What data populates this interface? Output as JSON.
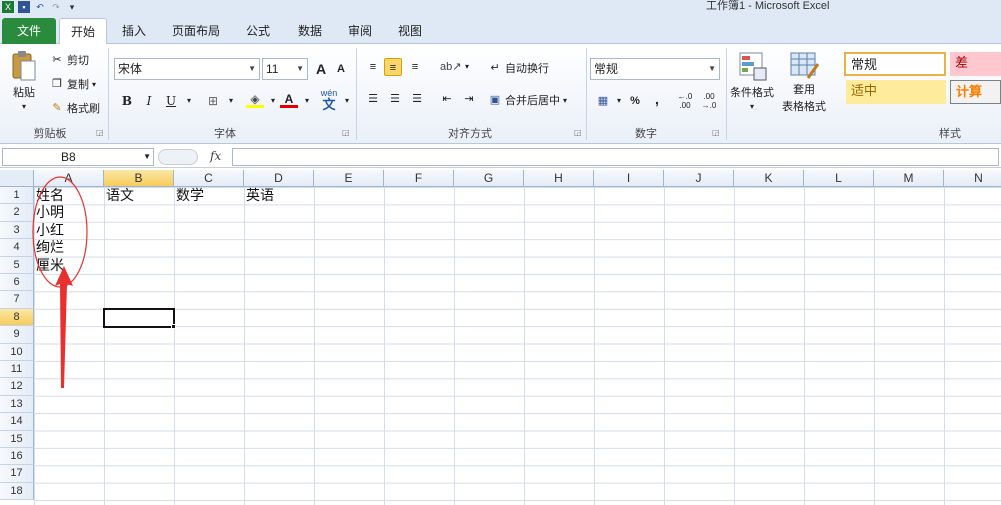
{
  "window": {
    "title": "工作簿1 - Microsoft Excel"
  },
  "tabs": [
    {
      "label": "文件"
    },
    {
      "label": "开始"
    },
    {
      "label": "插入"
    },
    {
      "label": "页面布局"
    },
    {
      "label": "公式"
    },
    {
      "label": "数据"
    },
    {
      "label": "审阅"
    },
    {
      "label": "视图"
    }
  ],
  "ribbon": {
    "clipboard": {
      "paste": "粘贴",
      "cut": "剪切",
      "copy": "复制",
      "format_painter": "格式刷",
      "label": "剪贴板"
    },
    "font": {
      "name": "宋体",
      "size": "11",
      "label": "字体",
      "bold": "B",
      "italic": "I",
      "underline": "U",
      "grow": "A",
      "shrink": "A",
      "font_color": "A"
    },
    "alignment": {
      "wrap_text": "自动换行",
      "merge_center": "合并后居中",
      "label": "对齐方式"
    },
    "number": {
      "format": "常规",
      "percent": "%",
      "comma": ",",
      "label": "数字"
    },
    "styles": {
      "conditional": "条件格式",
      "table_line1": "套用",
      "table_line2": "表格格式",
      "normal": "常规",
      "bad": "差",
      "neutral": "适中",
      "calc": "计算",
      "label": "样式"
    }
  },
  "formula_bar": {
    "name_box": "B8",
    "fx": "fx",
    "value": ""
  },
  "columns": [
    "A",
    "B",
    "C",
    "D",
    "E",
    "F",
    "G",
    "H",
    "I",
    "J",
    "K",
    "L",
    "M",
    "N"
  ],
  "rows": [
    "1",
    "2",
    "3",
    "4",
    "5",
    "6",
    "7",
    "8",
    "9",
    "10",
    "11",
    "12",
    "13",
    "14",
    "15",
    "16",
    "17",
    "18"
  ],
  "cells": {
    "A1": "姓名",
    "B1": "语文",
    "C1": "数学",
    "D1": "英语",
    "A2": "小明",
    "A3": "小红",
    "A4": "绚烂",
    "A5": "厘米"
  },
  "active": {
    "cell": "B8",
    "column": "B",
    "row": "8"
  },
  "colors": {
    "file_tab": "#2a8a3e",
    "header_selected": "#f6cc5a",
    "annotation": "#e8312f",
    "bad_style_bg": "#ffc7ce",
    "neutral_style_bg": "#ffeb9c"
  }
}
